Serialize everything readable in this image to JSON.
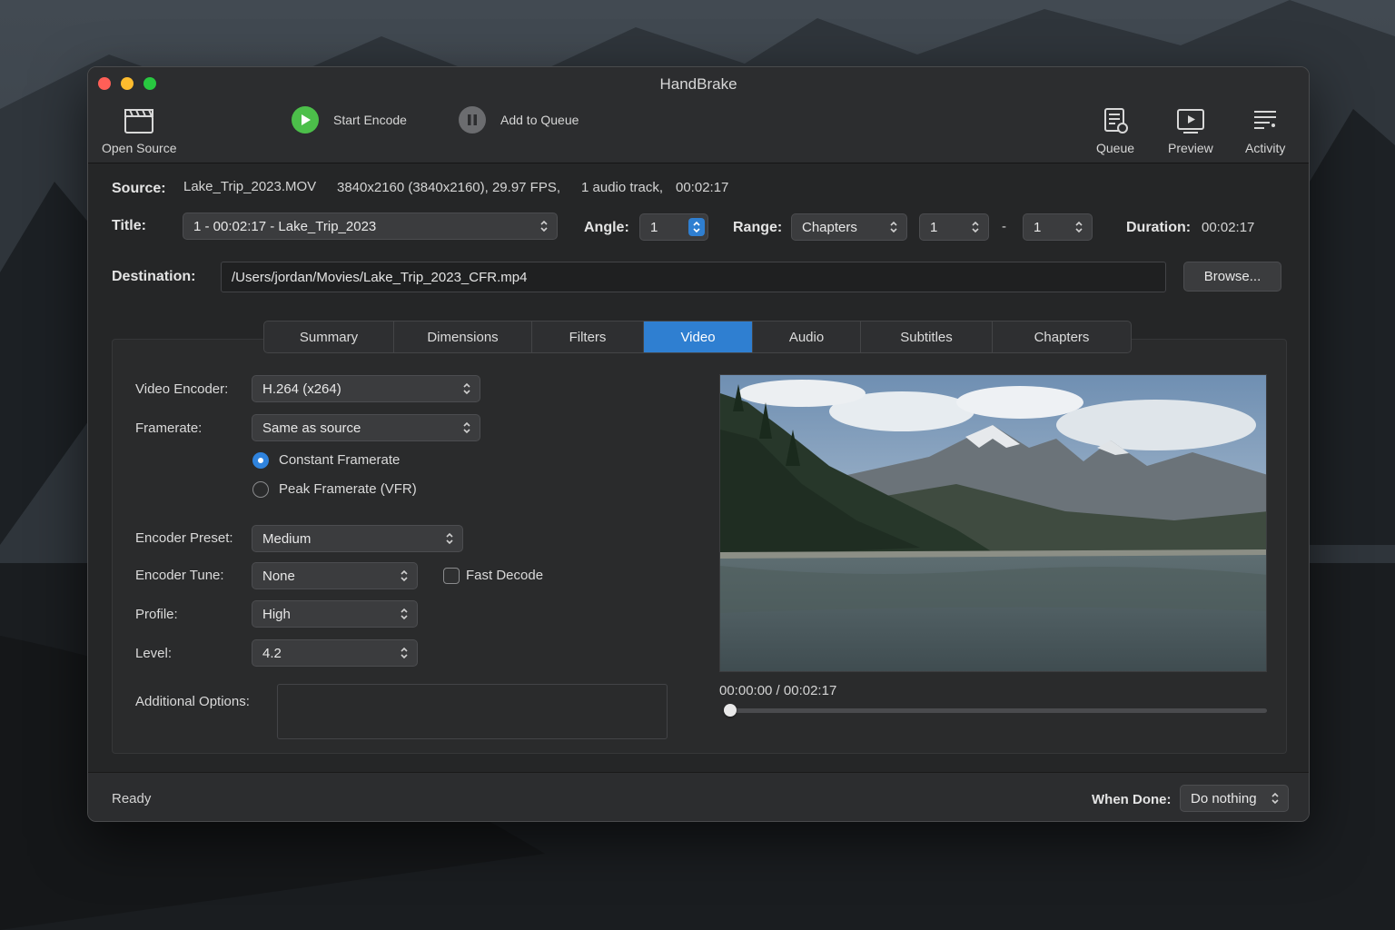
{
  "window": {
    "title": "HandBrake"
  },
  "toolbar": {
    "open_source": "Open Source",
    "start_encode": "Start Encode",
    "add_to_queue": "Add to Queue",
    "queue": "Queue",
    "preview": "Preview",
    "activity": "Activity"
  },
  "source": {
    "label": "Source:",
    "filename": "Lake_Trip_2023.MOV",
    "details": "3840x2160 (3840x2160), 29.97 FPS,",
    "audio": "1 audio track,",
    "duration": "00:02:17"
  },
  "title_row": {
    "title_label": "Title:",
    "title_value": "1 - 00:02:17 - Lake_Trip_2023",
    "angle_label": "Angle:",
    "angle_value": "1",
    "range_label": "Range:",
    "range_value": "Chapters",
    "range_start": "1",
    "range_sep": "-",
    "range_end": "1",
    "duration_label": "Duration:",
    "duration_value": "00:02:17"
  },
  "destination": {
    "label": "Destination:",
    "path": "/Users/jordan/Movies/Lake_Trip_2023_CFR.mp4",
    "browse": "Browse..."
  },
  "tabs": [
    {
      "label": "Summary"
    },
    {
      "label": "Dimensions"
    },
    {
      "label": "Filters"
    },
    {
      "label": "Video",
      "active": true
    },
    {
      "label": "Audio"
    },
    {
      "label": "Subtitles"
    },
    {
      "label": "Chapters"
    }
  ],
  "video": {
    "encoder_label": "Video Encoder:",
    "encoder_value": "H.264 (x264)",
    "framerate_label": "Framerate:",
    "framerate_value": "Same as source",
    "constant_framerate": "Constant Framerate",
    "peak_framerate": "Peak Framerate (VFR)",
    "framerate_mode": "constant",
    "preset_label": "Encoder Preset:",
    "preset_value": "Medium",
    "tune_label": "Encoder Tune:",
    "tune_value": "None",
    "fast_decode": "Fast Decode",
    "fast_decode_checked": false,
    "profile_label": "Profile:",
    "profile_value": "High",
    "level_label": "Level:",
    "level_value": "4.2",
    "additional_label": "Additional Options:",
    "additional_value": ""
  },
  "player": {
    "time": "00:00:00 / 00:02:17",
    "position": 0
  },
  "status": {
    "text": "Ready",
    "when_done_label": "When Done:",
    "when_done_value": "Do nothing"
  },
  "colors": {
    "accent": "#2f7fd1",
    "play_green": "#4cbf4a",
    "close": "#ff5f57",
    "minimize": "#febc2e",
    "zoom": "#28c840"
  }
}
